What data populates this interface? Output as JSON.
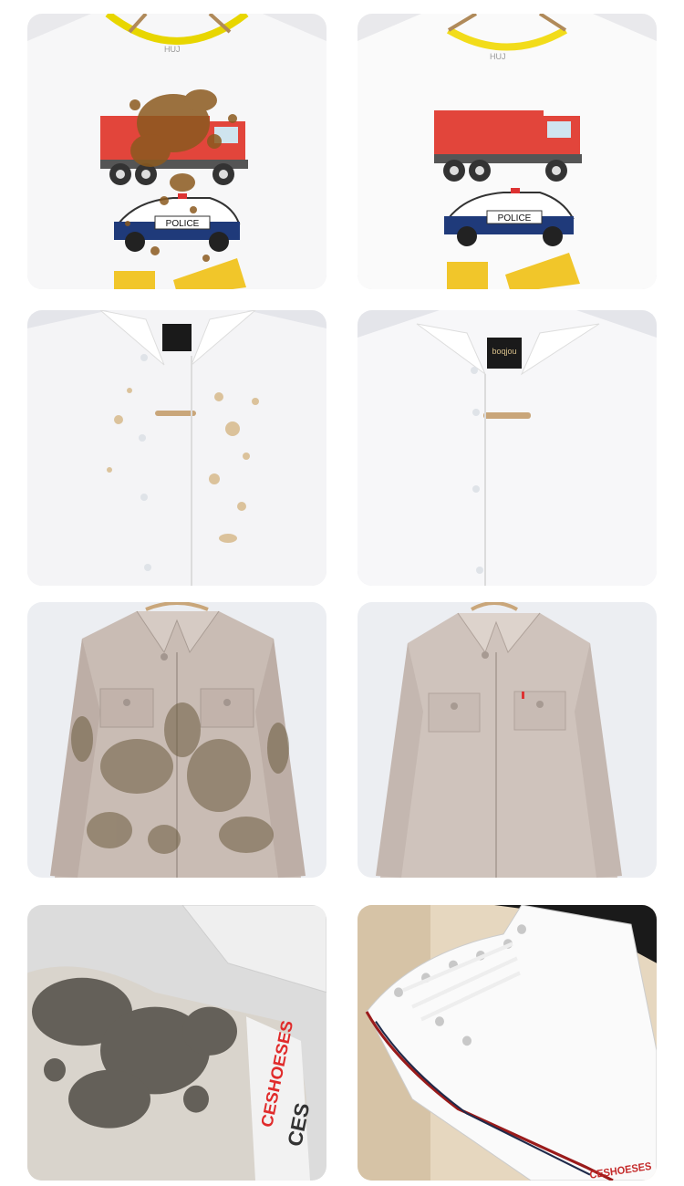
{
  "grid": {
    "rows": [
      {
        "subject": "kids-tshirt",
        "before": {
          "state": "stained"
        },
        "after": {
          "state": "clean"
        },
        "print_label": "POLICE",
        "collar_label_before": "",
        "collar_label_after": ""
      },
      {
        "subject": "white-shirt",
        "before": {
          "state": "stained"
        },
        "after": {
          "state": "clean"
        },
        "collar_label_before": "",
        "collar_label_after": "boqjou"
      },
      {
        "subject": "work-jacket",
        "before": {
          "state": "stained"
        },
        "after": {
          "state": "clean"
        }
      },
      {
        "subject": "canvas-sneaker",
        "before": {
          "state": "stained"
        },
        "after": {
          "state": "clean"
        },
        "heel_brand": "CESHOESES",
        "heel_brand_partial": "CES"
      }
    ]
  },
  "colors": {
    "stain_brown": "#8b5a1f",
    "grime_dark": "#3e3a33",
    "truck_red": "#e2453b",
    "police_blue": "#1f3a7a",
    "mixer_yellow": "#f1c62a",
    "jacket_beige": "#c9bcb4",
    "shirt_white": "#f6f6f8"
  }
}
